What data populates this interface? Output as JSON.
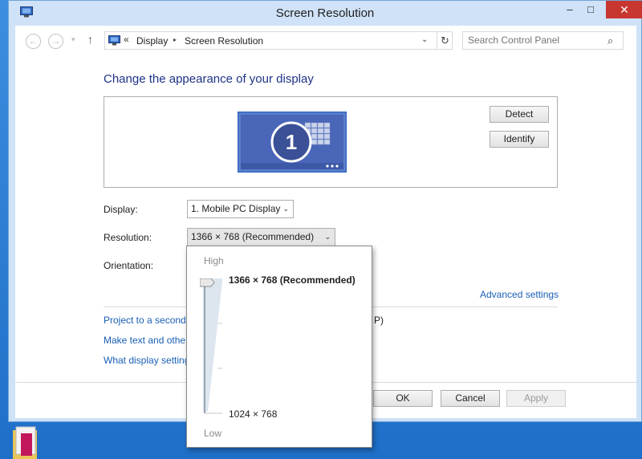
{
  "window": {
    "title": "Screen Resolution",
    "controls": {
      "minimize": "–",
      "maximize": "□",
      "close": "✕"
    }
  },
  "nav": {
    "back": "←",
    "forward": "→",
    "history": "▾",
    "up": "↑"
  },
  "address": {
    "chevron": "«",
    "segments": [
      "Display",
      "Screen Resolution"
    ],
    "separator": "▸",
    "dropdown": "⌄",
    "refresh": "↻"
  },
  "search": {
    "placeholder": "Search Control Panel",
    "icon": "search-icon"
  },
  "main": {
    "heading": "Change the appearance of your display",
    "monitor_number": "1",
    "detect": "Detect",
    "identify": "Identify",
    "display_label": "Display:",
    "display_value": "1. Mobile PC Display",
    "resolution_label": "Resolution:",
    "resolution_value": "1366 × 768 (Recommended)",
    "orientation_label": "Orientation:",
    "advanced_link": "Advanced settings",
    "links": {
      "project": "Project to a second",
      "project_tail": "P)",
      "text_size": "Make text and other",
      "what_settings": "What display setting"
    },
    "ok": "OK",
    "cancel": "Cancel",
    "apply": "Apply"
  },
  "resolution_popup": {
    "high": "High",
    "low": "Low",
    "top_value": "1366 × 768 (Recommended)",
    "bottom_value": "1024 × 768",
    "slider_level": 1.0
  },
  "colors": {
    "accent": "#1a5fb4",
    "heading": "#1e3287",
    "title_bar": "#cfe2f7",
    "close": "#c7372f",
    "desktop": "#2a7bd3"
  }
}
